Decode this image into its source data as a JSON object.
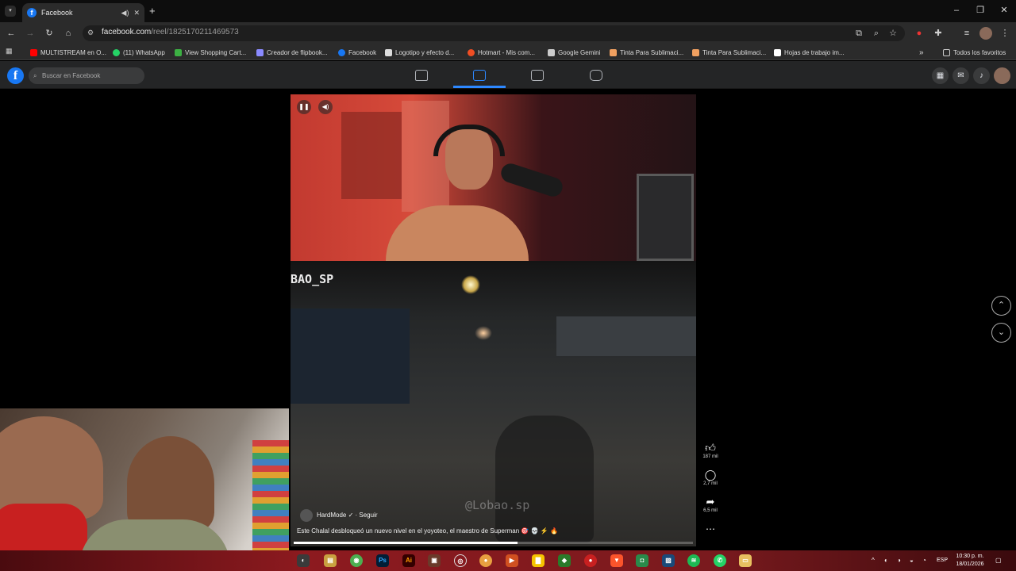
{
  "browser": {
    "tab_title": "Facebook",
    "tab_favicon": "f",
    "url_domain": "facebook.com",
    "url_path": "/reel/1825170211469573",
    "bookmarks": [
      {
        "label": "MULTISTREAM en O...",
        "icon": "youtube-icon",
        "color": "#ff0000"
      },
      {
        "label": "(11) WhatsApp",
        "icon": "whatsapp-icon",
        "color": "#25d366"
      },
      {
        "label": "View Shopping Cart...",
        "icon": "leaf-icon",
        "color": "#3cb043"
      },
      {
        "label": "Creador de flipbook...",
        "icon": "p-icon",
        "color": "#8a8aff"
      },
      {
        "label": "Facebook",
        "icon": "facebook-icon",
        "color": "#1877f2"
      },
      {
        "label": "Logotipo y efecto d...",
        "icon": "pen-icon",
        "color": "#dddddd"
      },
      {
        "label": "Hotmart - Mis com...",
        "icon": "fire-icon",
        "color": "#f04e23"
      },
      {
        "label": "Google Gemini",
        "icon": "sparkle-icon",
        "color": "#cccccc"
      },
      {
        "label": "Tinta Para Sublimaci...",
        "icon": "ink-icon",
        "color": "#f0a060"
      },
      {
        "label": "Tinta Para Sublimaci...",
        "icon": "ink-icon",
        "color": "#f0a060"
      },
      {
        "label": "Hojas de trabajo im...",
        "icon": "doc-icon",
        "color": "#ffffff"
      }
    ],
    "all_bookmarks_label": "Todos los favoritos"
  },
  "facebook": {
    "logo": "f",
    "search_placeholder": "Buscar en Facebook",
    "reel": {
      "channel_watermark": "BAO_SP",
      "video_watermark": "@Lobao.sp",
      "author": "HardMode ✓ · Seguir",
      "caption": "Este Chalal desbloqueó un nuevo nivel en el yoyoteo, el maestro de Superman 🎯 💀 ⚡ 🔥",
      "progress": 0.56,
      "likes": "187 mil",
      "comments": "2,7 mil",
      "shares": "6,5 mil"
    }
  },
  "taskbar": {
    "time": "10:30 p. m.",
    "date": "18/01/2026",
    "language": "ESP"
  },
  "colors": {
    "facebook_blue": "#1877f2",
    "active_nav": "#2d88ff"
  }
}
